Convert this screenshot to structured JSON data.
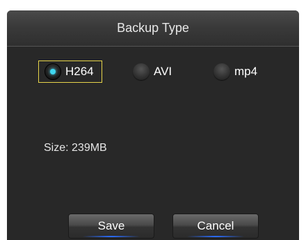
{
  "dialog": {
    "title": "Backup Type"
  },
  "backup_type": {
    "options": [
      {
        "label": "H264",
        "selected": true
      },
      {
        "label": "AVI",
        "selected": false
      },
      {
        "label": "mp4",
        "selected": false
      }
    ]
  },
  "size": {
    "text": "Size: 239MB"
  },
  "buttons": {
    "save_label": "Save",
    "cancel_label": "Cancel"
  },
  "colors": {
    "focus_border": "#e6d44a",
    "selected_dot": "#3fd6f0",
    "button_underline": "#2a6cff"
  }
}
